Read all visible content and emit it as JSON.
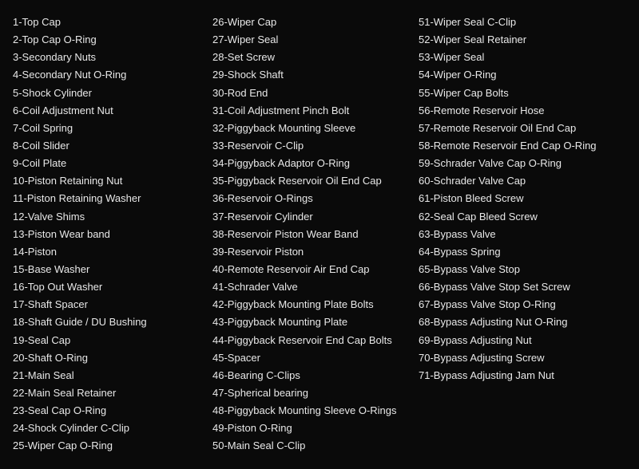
{
  "columns": [
    {
      "id": "col1",
      "items": [
        "1-Top Cap",
        "2-Top Cap O-Ring",
        "3-Secondary Nuts",
        "4-Secondary Nut O-Ring",
        "5-Shock Cylinder",
        "6-Coil Adjustment Nut",
        "7-Coil Spring",
        "8-Coil Slider",
        "9-Coil Plate",
        "10-Piston Retaining Nut",
        "11-Piston Retaining Washer",
        "12-Valve Shims",
        "13-Piston Wear band",
        "14-Piston",
        "15-Base Washer",
        "16-Top Out Washer",
        "17-Shaft Spacer",
        "18-Shaft Guide / DU Bushing",
        "19-Seal Cap",
        "20-Shaft O-Ring",
        "21-Main Seal",
        "22-Main Seal Retainer",
        "23-Seal Cap O-Ring",
        "24-Shock Cylinder C-Clip",
        "25-Wiper Cap O-Ring"
      ]
    },
    {
      "id": "col2",
      "items": [
        "26-Wiper Cap",
        "27-Wiper Seal",
        "28-Set Screw",
        "29-Shock Shaft",
        "30-Rod End",
        "31-Coil Adjustment Pinch Bolt",
        "32-Piggyback Mounting Sleeve",
        "33-Reservoir C-Clip",
        "34-Piggyback Adaptor O-Ring",
        "35-Piggyback Reservoir Oil End Cap",
        "36-Reservoir O-Rings",
        "37-Reservoir Cylinder",
        "38-Reservoir Piston Wear Band",
        "39-Reservoir Piston",
        "40-Remote Reservoir Air End Cap",
        "41-Schrader Valve",
        "42-Piggyback Mounting Plate Bolts",
        "43-Piggyback Mounting Plate",
        "44-Piggyback Reservoir End Cap Bolts",
        "45-Spacer",
        "46-Bearing C-Clips",
        "47-Spherical bearing",
        "48-Piggyback Mounting Sleeve O-Rings",
        "49-Piston O-Ring",
        "50-Main Seal C-Clip"
      ]
    },
    {
      "id": "col3",
      "items": [
        "51-Wiper Seal C-Clip",
        "52-Wiper Seal Retainer",
        "53-Wiper Seal",
        "54-Wiper O-Ring",
        "55-Wiper Cap Bolts",
        "56-Remote Reservoir Hose",
        "57-Remote Reservoir Oil End Cap",
        "58-Remote Reservoir End Cap O-Ring",
        "59-Schrader Valve Cap O-Ring",
        "60-Schrader Valve Cap",
        "61-Piston Bleed Screw",
        "62-Seal Cap Bleed Screw",
        "63-Bypass Valve",
        "64-Bypass Spring",
        "65-Bypass Valve Stop",
        "66-Bypass Valve Stop Set Screw",
        "67-Bypass Valve Stop O-Ring",
        "68-Bypass Adjusting Nut O-Ring",
        "69-Bypass Adjusting Nut",
        "70-Bypass Adjusting Screw",
        "71-Bypass Adjusting Jam Nut"
      ]
    }
  ]
}
